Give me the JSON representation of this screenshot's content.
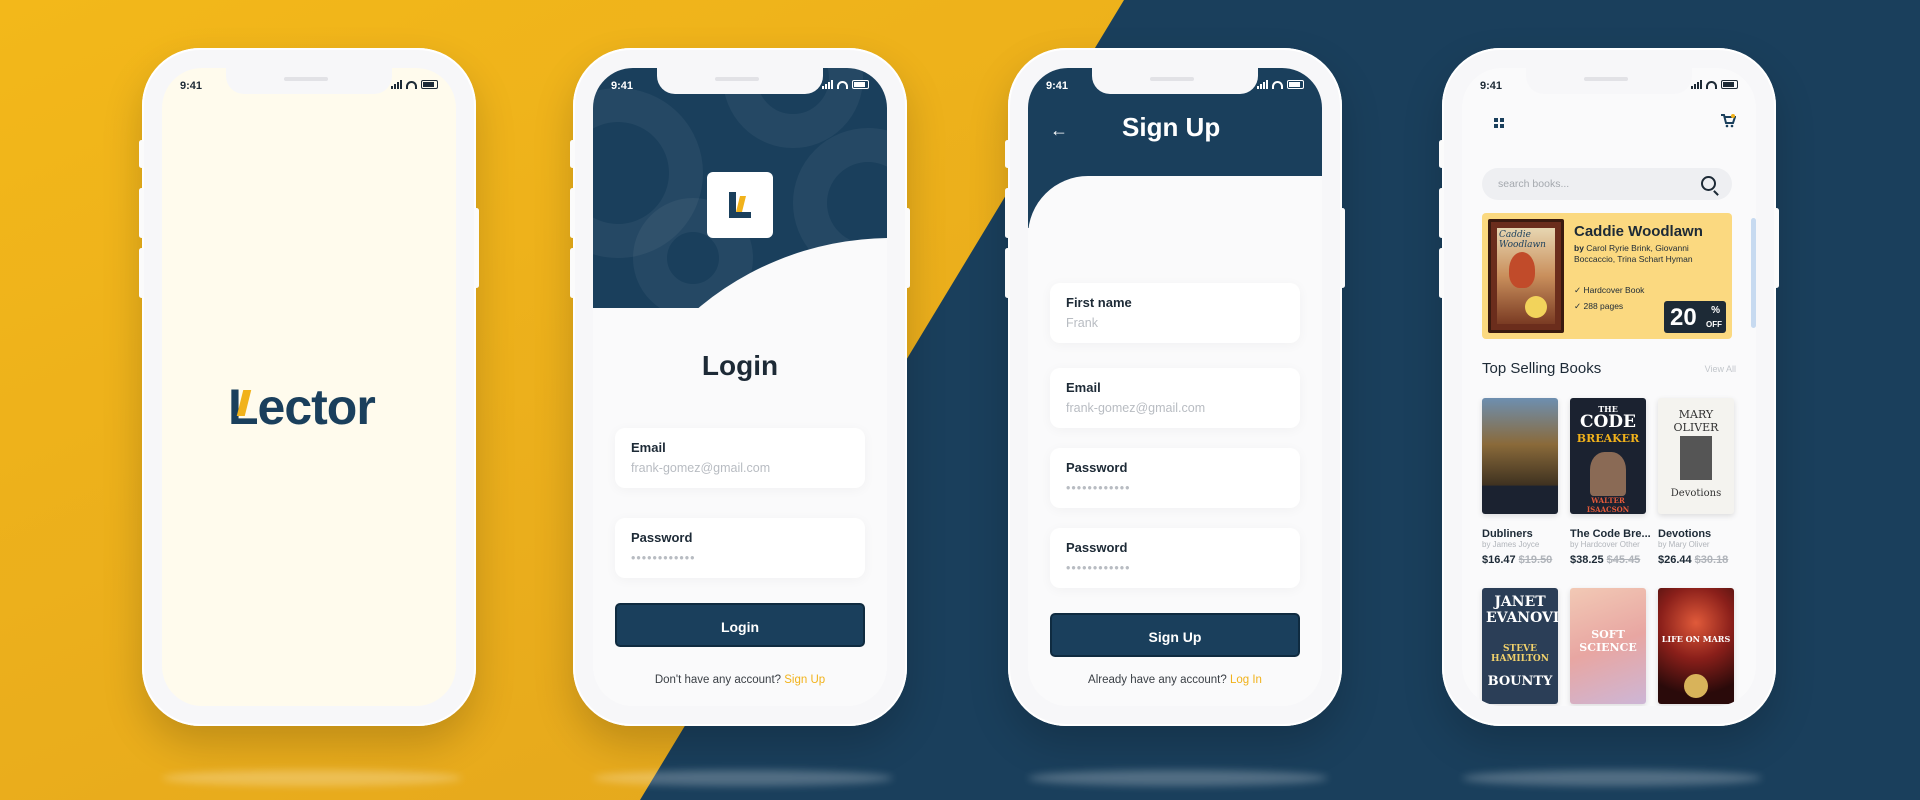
{
  "colors": {
    "navy": "#1a3f5c",
    "yellow": "#f1b21b",
    "dark_text": "#1d2a36"
  },
  "status_time": "9:41",
  "splash": {
    "brand": "Lector"
  },
  "login": {
    "title": "Login",
    "email_label": "Email",
    "email_value": "frank-gomez@gmail.com",
    "password_label": "Password",
    "password_value": "••••••••••••",
    "button": "Login",
    "footer_text": "Don't have any account?",
    "footer_link": "Sign Up"
  },
  "signup": {
    "title": "Sign Up",
    "back_icon": "arrow-left-icon",
    "first_name_label": "First name",
    "first_name_value": "Frank",
    "email_label": "Email",
    "email_value": "frank-gomez@gmail.com",
    "password_label": "Password",
    "password_value": "••••••••••••",
    "confirm_label": "Password",
    "confirm_value": "••••••••••••",
    "button": "Sign Up",
    "footer_text": "Already have any account?",
    "footer_link": "Log In"
  },
  "store": {
    "search_placeholder": "search books...",
    "promo": {
      "cover_title": "Caddie Woodlawn",
      "title": "Caddie Woodlawn",
      "by_prefix": "by",
      "authors": "Carol Ryrie Brink, Giovanni Boccaccio, Trina Schart Hyman",
      "feature_1": "Hardcover Book",
      "feature_2": "288 pages",
      "discount": "20",
      "discount_pct": "%",
      "discount_off": "OFF"
    },
    "section_title": "Top Selling Books",
    "view_all": "View All",
    "books": [
      {
        "title": "Dubliners",
        "author": "by James Joyce",
        "price": "$16.47",
        "old_price": "$19.50"
      },
      {
        "title": "The Code Bre...",
        "author": "by Hardcover Other",
        "price": "$38.25",
        "old_price": "$45.45"
      },
      {
        "title": "Devotions",
        "author": "by Mary Oliver",
        "price": "$26.44",
        "old_price": "$30.18"
      }
    ],
    "covers": {
      "code_1": "THE",
      "code_2": "CODE",
      "code_3": "BREAKER",
      "code_author": "WALTER ISAACSON",
      "devotions_author": "MARY OLIVER",
      "devotions_title": "Devotions",
      "janet": "JANET EVANOVICH",
      "bounty_author": "STEVE HAMILTON",
      "bounty_title": "BOUNTY",
      "soft_science": "SOFT SCIENCE",
      "mars": "LIFE ON MARS"
    }
  }
}
